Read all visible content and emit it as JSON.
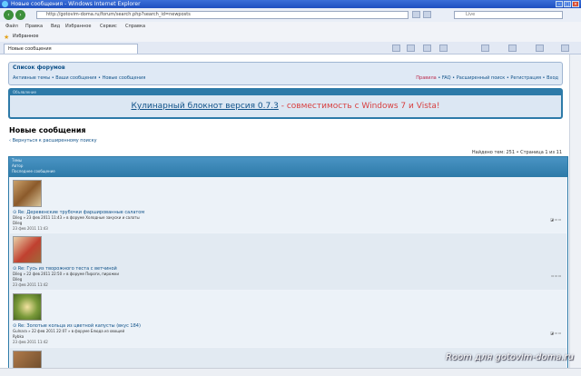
{
  "window": {
    "title": "Новые сообщения - Windows Internet Explorer"
  },
  "address": {
    "url": "http://gotovim-doma.ru/forum/search.php?search_id=newposts",
    "search_label": "Live"
  },
  "menu": {
    "items": [
      "Файл",
      "Правка",
      "Вид",
      "Избранное",
      "Сервис",
      "Справка"
    ]
  },
  "favorites": {
    "label": "Избранное"
  },
  "tab": {
    "label": "Новые сообщения"
  },
  "forum_nav": {
    "crumb": "Список форумов",
    "quick_links": "Активные темы • Ваши сообщения • Новые сообщения",
    "rules": "Правила",
    "faq": "FAQ",
    "search": "Расширенный поиск",
    "register": "Регистрация",
    "login": "Вход"
  },
  "banner": {
    "header": "Объявление",
    "link_text": "Кулинарный блокнот версия 0.7.3",
    "suffix": " - совместимость с Windows 7 и Vista!"
  },
  "page": {
    "title": "Новые сообщения",
    "back_link": "Вернуться к расширенному поиску",
    "pagination": "Найдено тем: 251 • Страница 1 из 11"
  },
  "table_head": {
    "l1": "Темы",
    "l2": "Автор",
    "l3": "Последнее сообщение"
  },
  "rows": [
    {
      "title": "Re: Деревенские трубочки фаршированные салатом",
      "sub": "Dileg » 23 фев 2011 11:43 » в форуме Холодные закуски и салаты",
      "author": "Dileg",
      "time": "23 фев 2011 11:43"
    },
    {
      "title": "Re: Гусь из творожного теста с ветчиной",
      "sub": "Dileg » 22 фев 2011 22:50 » в форуме Пироги, пирожки",
      "author": "Dileg",
      "time": "23 фев 2011 11:42"
    },
    {
      "title": "Re: Золотые кольца из цветной капусты (вкус 184)",
      "sub": "Gulnara » 22 фев 2011 22:07 » в форуме Блюда из овощей",
      "author": "Rybka",
      "time": "23 фев 2011 11:42"
    }
  ],
  "watermark": "Room для gotovim-doma.ru"
}
